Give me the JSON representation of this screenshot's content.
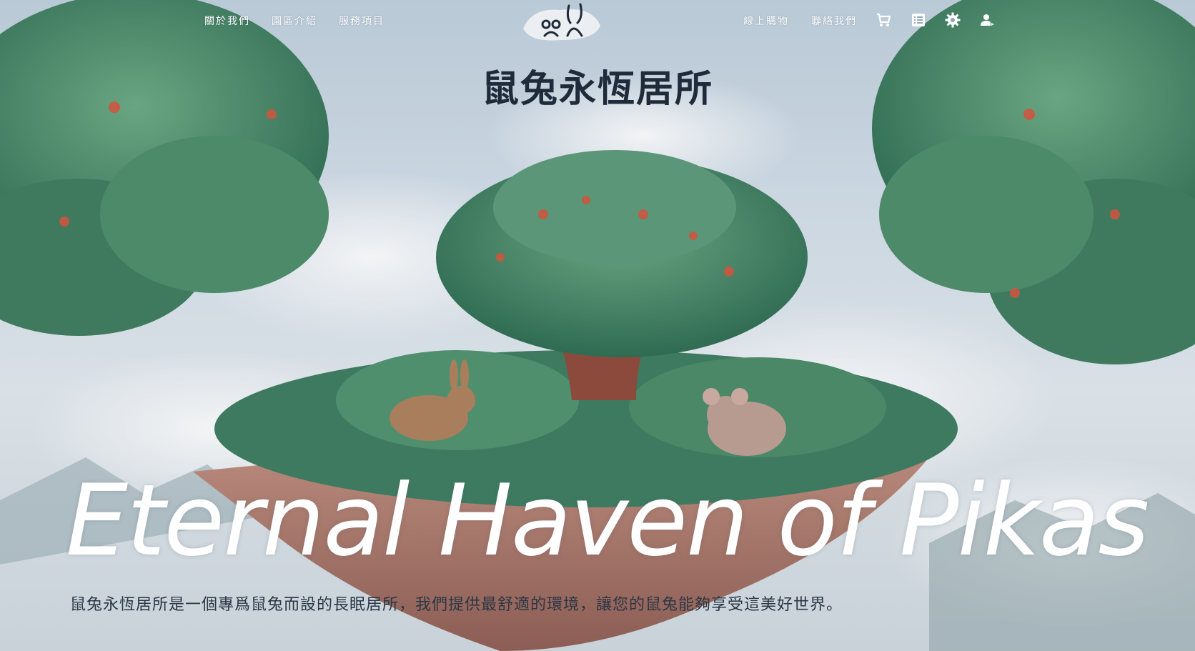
{
  "nav": {
    "left": [
      "關於我們",
      "園區介紹",
      "服務項目"
    ],
    "right": [
      "線上購物",
      "聯絡我們"
    ],
    "icons": [
      "cart-icon",
      "list-icon",
      "settings-icon",
      "user-icon"
    ]
  },
  "hero": {
    "title": "鼠兔永恆居所",
    "headline": "Eternal Haven of Pikas",
    "tagline": "鼠兔永恆居所是一個專爲鼠兔而設的長眠居所，我們提供最舒適的環境，讓您的鼠兔能夠享受這美好世界。"
  },
  "colors": {
    "title": "#1f2b3a",
    "nav_text": "#ffffff",
    "foliage": "#4e8a6c",
    "trunk": "#8c4a3c",
    "sky": "#cdd8e2"
  }
}
